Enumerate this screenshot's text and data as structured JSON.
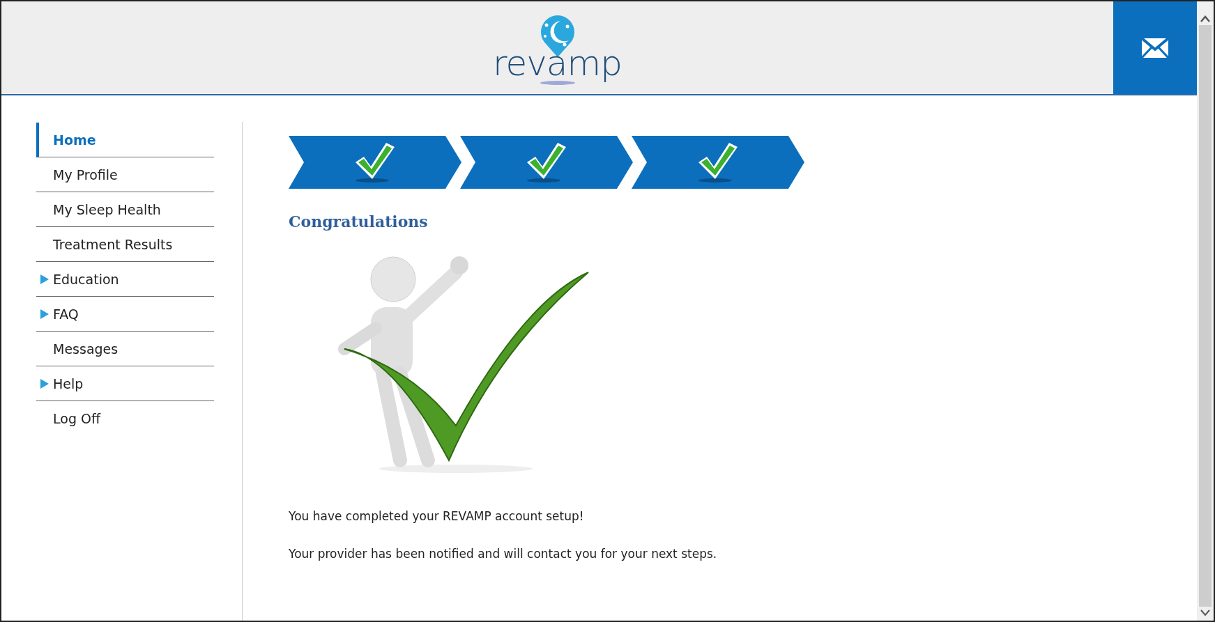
{
  "header": {
    "logo_text": "revamp"
  },
  "sidebar": {
    "items": [
      {
        "label": "Home",
        "selected": true,
        "expandable": false
      },
      {
        "label": "My Profile",
        "selected": false,
        "expandable": false
      },
      {
        "label": "My Sleep Health",
        "selected": false,
        "expandable": false
      },
      {
        "label": "Treatment Results",
        "selected": false,
        "expandable": false
      },
      {
        "label": "Education",
        "selected": false,
        "expandable": true
      },
      {
        "label": "FAQ",
        "selected": false,
        "expandable": true
      },
      {
        "label": "Messages",
        "selected": false,
        "expandable": false
      },
      {
        "label": "Help",
        "selected": false,
        "expandable": true
      },
      {
        "label": "Log Off",
        "selected": false,
        "expandable": false
      }
    ]
  },
  "steps": [
    {
      "completed": true
    },
    {
      "completed": true
    },
    {
      "completed": true
    }
  ],
  "main": {
    "title": "Congratulations",
    "paragraphs": [
      "You have completed your REVAMP account setup!",
      "Your provider has been notified and will contact you for your next steps."
    ]
  }
}
